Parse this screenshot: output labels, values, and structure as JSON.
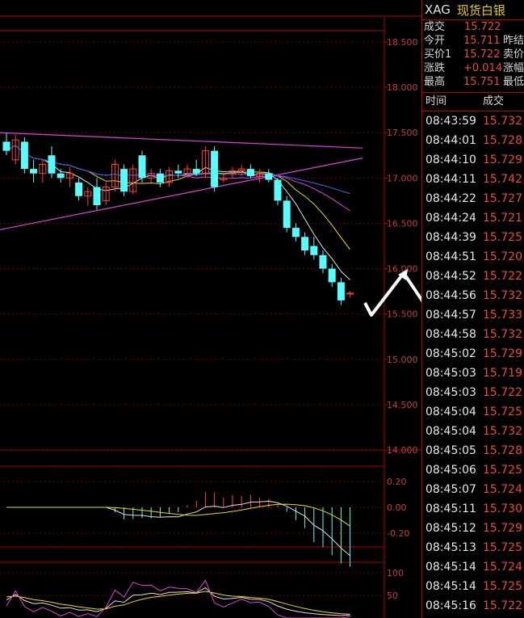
{
  "chart_data": {
    "type": "candlestick",
    "price_axis": {
      "ticks": [
        "18.500",
        "18.000",
        "17.500",
        "17.000",
        "16.500",
        "16.000",
        "15.500",
        "15.000",
        "14.500",
        "14.000"
      ],
      "min": 14.0,
      "max": 18.5
    },
    "macd_axis": {
      "ticks": [
        "0.20",
        "0.00",
        "-0.20"
      ],
      "min": -0.3,
      "max": 0.3
    },
    "kdj_axis": {
      "ticks": [
        "100",
        "50"
      ],
      "min": 0,
      "max": 120
    },
    "candles": [
      {
        "o": 17.4,
        "h": 17.5,
        "l": 17.25,
        "c": 17.3
      },
      {
        "o": 17.2,
        "h": 17.48,
        "l": 17.15,
        "c": 17.42
      },
      {
        "o": 17.4,
        "h": 17.45,
        "l": 17.05,
        "c": 17.1
      },
      {
        "o": 17.1,
        "h": 17.2,
        "l": 16.95,
        "c": 17.05
      },
      {
        "o": 17.05,
        "h": 17.2,
        "l": 16.95,
        "c": 17.15
      },
      {
        "o": 17.25,
        "h": 17.35,
        "l": 17.0,
        "c": 17.05
      },
      {
        "o": 17.05,
        "h": 17.1,
        "l": 16.95,
        "c": 17.0
      },
      {
        "o": 17.0,
        "h": 17.12,
        "l": 16.9,
        "c": 17.05
      },
      {
        "o": 16.95,
        "h": 17.0,
        "l": 16.75,
        "c": 16.8
      },
      {
        "o": 16.8,
        "h": 16.9,
        "l": 16.7,
        "c": 16.85
      },
      {
        "o": 16.9,
        "h": 17.0,
        "l": 16.65,
        "c": 16.7
      },
      {
        "o": 16.75,
        "h": 16.95,
        "l": 16.7,
        "c": 16.9
      },
      {
        "o": 16.9,
        "h": 17.2,
        "l": 16.85,
        "c": 17.15
      },
      {
        "o": 17.1,
        "h": 17.15,
        "l": 16.8,
        "c": 16.85
      },
      {
        "o": 16.85,
        "h": 17.15,
        "l": 16.82,
        "c": 17.1
      },
      {
        "o": 17.25,
        "h": 17.3,
        "l": 16.95,
        "c": 17.0
      },
      {
        "o": 17.0,
        "h": 17.1,
        "l": 16.95,
        "c": 17.05
      },
      {
        "o": 17.05,
        "h": 17.1,
        "l": 16.9,
        "c": 16.95
      },
      {
        "o": 16.95,
        "h": 17.12,
        "l": 16.9,
        "c": 17.08
      },
      {
        "o": 17.08,
        "h": 17.15,
        "l": 17.0,
        "c": 17.05
      },
      {
        "o": 17.05,
        "h": 17.15,
        "l": 17.0,
        "c": 17.1
      },
      {
        "o": 17.1,
        "h": 17.2,
        "l": 17.02,
        "c": 17.05
      },
      {
        "o": 17.05,
        "h": 17.35,
        "l": 17.0,
        "c": 17.3
      },
      {
        "o": 17.3,
        "h": 17.35,
        "l": 16.85,
        "c": 16.9
      },
      {
        "o": 16.98,
        "h": 17.05,
        "l": 16.95,
        "c": 17.0
      },
      {
        "o": 17.05,
        "h": 17.12,
        "l": 17.0,
        "c": 17.08
      },
      {
        "o": 17.08,
        "h": 17.15,
        "l": 17.02,
        "c": 17.1
      },
      {
        "o": 17.1,
        "h": 17.15,
        "l": 17.0,
        "c": 17.02
      },
      {
        "o": 17.02,
        "h": 17.1,
        "l": 16.95,
        "c": 17.05
      },
      {
        "o": 17.05,
        "h": 17.1,
        "l": 16.95,
        "c": 16.98
      },
      {
        "o": 16.98,
        "h": 17.0,
        "l": 16.7,
        "c": 16.75
      },
      {
        "o": 16.75,
        "h": 16.8,
        "l": 16.4,
        "c": 16.45
      },
      {
        "o": 16.45,
        "h": 16.5,
        "l": 16.3,
        "c": 16.35
      },
      {
        "o": 16.35,
        "h": 16.4,
        "l": 16.15,
        "c": 16.2
      },
      {
        "o": 16.25,
        "h": 16.35,
        "l": 16.1,
        "c": 16.15
      },
      {
        "o": 16.15,
        "h": 16.2,
        "l": 15.95,
        "c": 16.0
      },
      {
        "o": 16.0,
        "h": 16.05,
        "l": 15.8,
        "c": 15.85
      },
      {
        "o": 15.85,
        "h": 15.9,
        "l": 15.6,
        "c": 15.65
      },
      {
        "o": 15.72,
        "h": 15.75,
        "l": 15.68,
        "c": 15.73
      }
    ],
    "trend_lines": [
      {
        "x1": 0,
        "y1": 17.5,
        "x2": 38.5,
        "y2": 17.33
      },
      {
        "x1": 0,
        "y1": 16.43,
        "x2": 38.5,
        "y2": 17.22
      }
    ]
  },
  "panel": {
    "code": "XAG",
    "name": "现货白银",
    "quote": [
      {
        "k": "成交",
        "v": "15.722",
        "k2": ""
      },
      {
        "k": "今开",
        "v": "15.711",
        "k2": "昨结"
      },
      {
        "k": "买价1",
        "v": "15.722",
        "k2": "卖价"
      },
      {
        "k": "涨跌",
        "v": "+0.014",
        "k2": "涨幅"
      },
      {
        "k": "最高",
        "v": "15.751",
        "k2": "最低"
      }
    ],
    "table_head": {
      "time": "时间",
      "price": "成交"
    },
    "ticks": [
      {
        "t": "08:43:59",
        "p": "15.732"
      },
      {
        "t": "08:44:01",
        "p": "15.728"
      },
      {
        "t": "08:44:10",
        "p": "15.729"
      },
      {
        "t": "08:44:11",
        "p": "15.742"
      },
      {
        "t": "08:44:22",
        "p": "15.727"
      },
      {
        "t": "08:44:24",
        "p": "15.721"
      },
      {
        "t": "08:44:39",
        "p": "15.725"
      },
      {
        "t": "08:44:51",
        "p": "15.720"
      },
      {
        "t": "08:44:52",
        "p": "15.722"
      },
      {
        "t": "08:44:56",
        "p": "15.732"
      },
      {
        "t": "08:44:57",
        "p": "15.733"
      },
      {
        "t": "08:44:58",
        "p": "15.732"
      },
      {
        "t": "08:45:02",
        "p": "15.729"
      },
      {
        "t": "08:45:03",
        "p": "15.719"
      },
      {
        "t": "08:45:03",
        "p": "15.722"
      },
      {
        "t": "08:45:04",
        "p": "15.725"
      },
      {
        "t": "08:45:04",
        "p": "15.732"
      },
      {
        "t": "08:45:05",
        "p": "15.728"
      },
      {
        "t": "08:45:06",
        "p": "15.725"
      },
      {
        "t": "08:45:07",
        "p": "15.724"
      },
      {
        "t": "08:45:11",
        "p": "15.730"
      },
      {
        "t": "08:45:12",
        "p": "15.729"
      },
      {
        "t": "08:45:13",
        "p": "15.725"
      },
      {
        "t": "08:45:14",
        "p": "15.724"
      },
      {
        "t": "08:45:14",
        "p": "15.725"
      },
      {
        "t": "08:45:16",
        "p": "15.722"
      }
    ]
  },
  "colors": {
    "up": "#ff4040",
    "down": "#54ffff",
    "axis": "#b40000",
    "grid": "#6a0000"
  }
}
